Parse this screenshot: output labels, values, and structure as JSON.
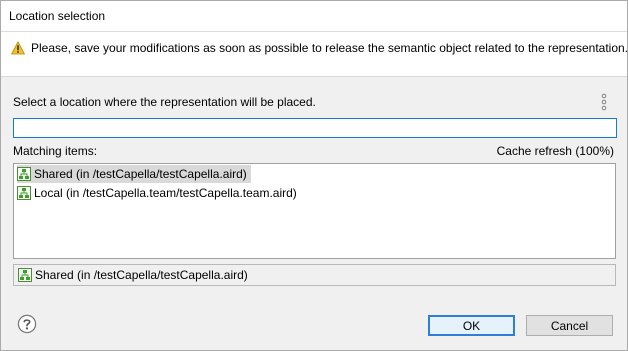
{
  "window": {
    "title": "Location selection"
  },
  "message": {
    "icon": "warning-icon",
    "text": "Please, save your modifications as soon as possible to release the semantic object related to the representation."
  },
  "instruction": "Select a location where the representation will be placed.",
  "filter": {
    "value": "",
    "placeholder": ""
  },
  "matching": {
    "label": "Matching items:",
    "cache_status": "Cache refresh (100%)",
    "items": [
      {
        "label": "Shared (in /testCapella/testCapella.aird)",
        "icon": "aird-resource-icon",
        "selected": true
      },
      {
        "label": "Local (in /testCapella.team/testCapella.team.aird)",
        "icon": "aird-resource-icon",
        "selected": false
      }
    ]
  },
  "selection_status": {
    "label": "Shared (in /testCapella/testCapella.aird)",
    "icon": "aird-resource-icon"
  },
  "buttons": {
    "help_icon": "help-icon",
    "ok": "OK",
    "cancel": "Cancel"
  },
  "colors": {
    "accent": "#1979ca",
    "selection": "#d9d9d9",
    "warning": "#f2c029"
  }
}
